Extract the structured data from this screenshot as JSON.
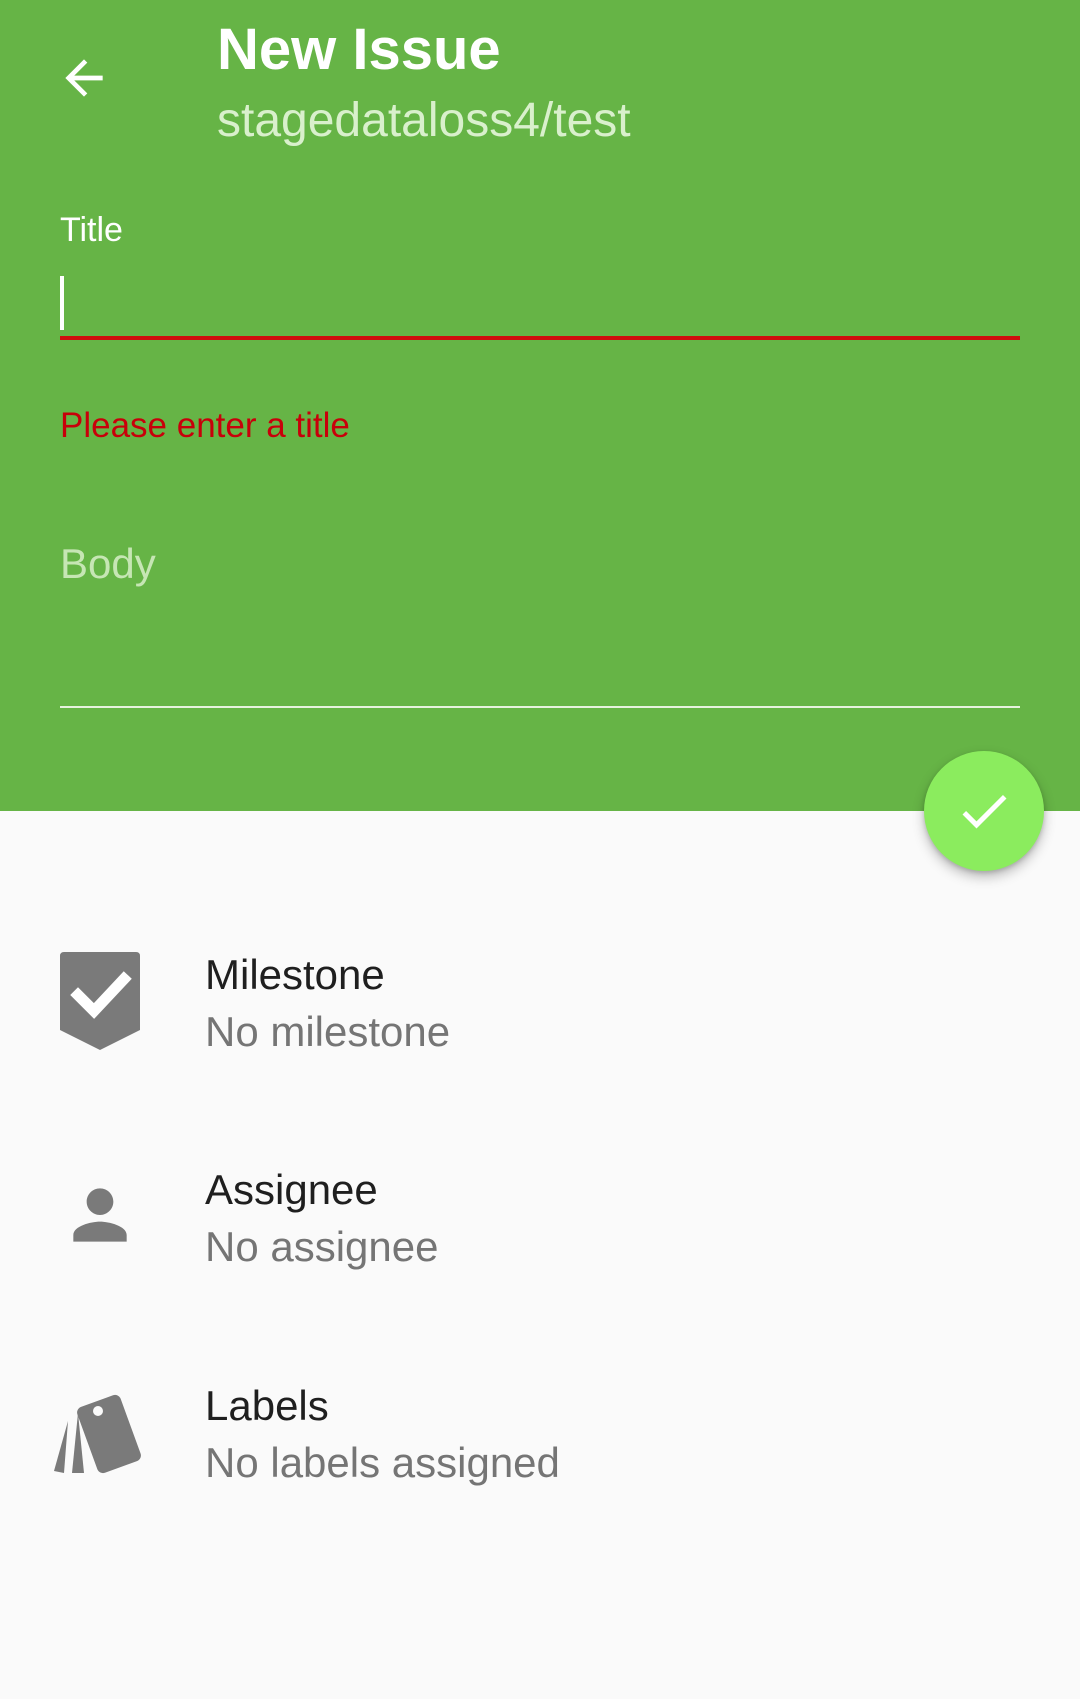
{
  "header": {
    "title": "New Issue",
    "repository": "stagedataloss4/test",
    "background_color": "#66b446",
    "back_icon": "arrow-back-icon"
  },
  "form": {
    "title_label": "Title",
    "title_value": "",
    "title_error": "Please enter a title",
    "body_placeholder": "Body",
    "body_value": ""
  },
  "fab": {
    "icon": "check-icon",
    "color": "#8bec5e"
  },
  "details": [
    {
      "title": "Milestone",
      "value": "No milestone",
      "icon": "milestone-icon"
    },
    {
      "title": "Assignee",
      "value": "No assignee",
      "icon": "person-icon"
    },
    {
      "title": "Labels",
      "value": "No labels assigned",
      "icon": "label-icon"
    }
  ],
  "colors": {
    "error": "#c8000a",
    "icon_gray": "#7a7a7a"
  }
}
